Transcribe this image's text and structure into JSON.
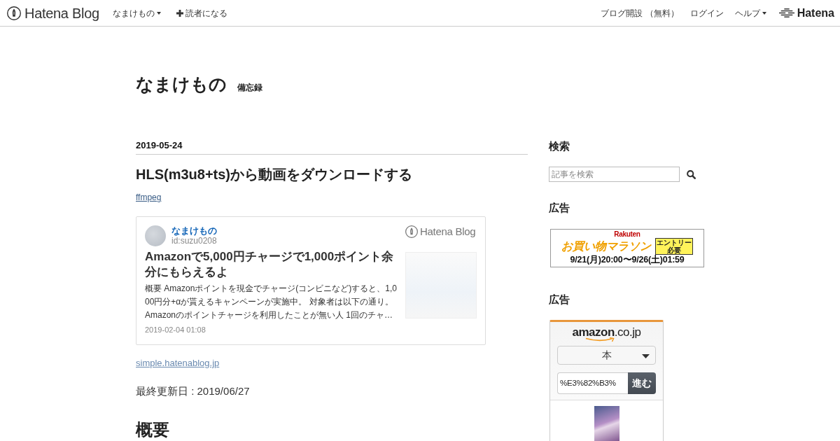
{
  "navbar": {
    "logo": "Hatena Blog",
    "left_menu": [
      {
        "label": "なまけもの",
        "kind": "dropdown"
      },
      {
        "label": "読者になる",
        "kind": "add"
      }
    ],
    "right_menu": [
      {
        "label": "ブログ開設 （無料）",
        "kind": "link"
      },
      {
        "label": "ログイン",
        "kind": "link"
      },
      {
        "label": "ヘルプ",
        "kind": "dropdown"
      }
    ],
    "brand": "Hatena"
  },
  "blog_header": {
    "title": "なまけもの",
    "tagline": "備忘録"
  },
  "article": {
    "date": "2019-05-24",
    "title": "HLS(m3u8+ts)から動画をダウンロードする",
    "category": "ffmpeg",
    "embed_card": {
      "author": "なまけもの",
      "author_id": "id:suzu0208",
      "logo": "Hatena Blog",
      "title": "Amazonで5,000円チャージで1,000ポイント余分にもらえるよ",
      "excerpt": "概要 Amazonポイントを現金でチャージ(コンビニなど)すると、1,000円分+αが貰えるキャンペーンが実施中。 対象者は以下の通り。 Amazonのポイントチャージを利用したことが無い人 1回のチャ…",
      "timestamp": "2019-02-04 01:08"
    },
    "source_link": "simple.hatenablog.jp",
    "updated": "最終更新日 : 2019/06/27",
    "section_heading": "概要"
  },
  "sidebar": {
    "search": {
      "heading": "検索",
      "placeholder": "記事を検索"
    },
    "ads": [
      {
        "heading": "広告",
        "kind": "banner",
        "brand": "Rakuten",
        "headline": "お買い物マラソン",
        "badge": "エントリー必要",
        "dates": "9/21(月)20:00〜9/26(土)01:59"
      },
      {
        "heading": "広告",
        "kind": "shop_widget",
        "logo": "**amazon**.co.jp",
        "category": "本",
        "query": "%E3%82%B3%",
        "button": "進む"
      }
    ]
  }
}
